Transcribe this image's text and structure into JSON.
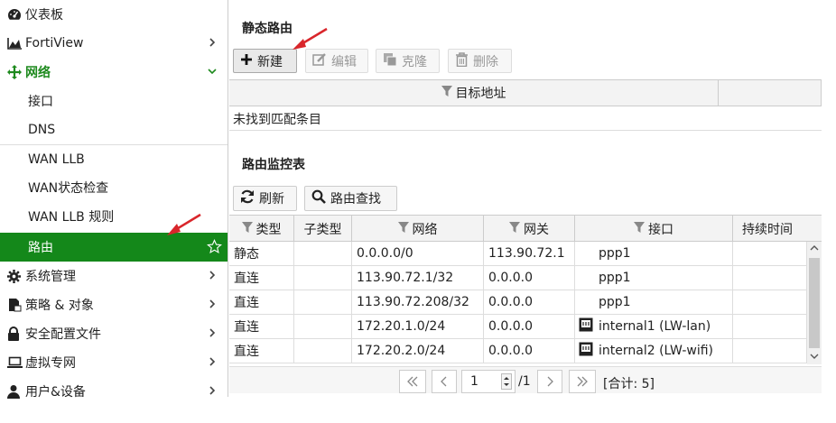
{
  "sidebar": {
    "items": [
      {
        "label": "仪表板",
        "icon": "dashboard-icon"
      },
      {
        "label": "FortiView",
        "icon": "fortiview-chart-icon"
      },
      {
        "label": "网络",
        "icon": "network-move-icon"
      },
      {
        "label": "接口"
      },
      {
        "label": "DNS"
      },
      {
        "label": "WAN LLB"
      },
      {
        "label": "WAN状态检查"
      },
      {
        "label": "WAN LLB 规则"
      },
      {
        "label": "路由"
      },
      {
        "label": "系统管理",
        "icon": "gear-icon"
      },
      {
        "label": "策略 & 对象",
        "icon": "policy-icon"
      },
      {
        "label": "安全配置文件",
        "icon": "lock-icon"
      },
      {
        "label": "虚拟专网",
        "icon": "laptop-icon"
      },
      {
        "label": "用户&设备",
        "icon": "user-icon"
      }
    ]
  },
  "static_route": {
    "title": "静态路由",
    "buttons": {
      "new": "新建",
      "edit": "编辑",
      "clone": "克隆",
      "delete": "删除"
    },
    "columns": [
      "目标地址"
    ],
    "empty": "未找到匹配条目"
  },
  "monitor": {
    "title": "路由监控表",
    "buttons": {
      "refresh": "刷新",
      "lookup": "路由查找"
    },
    "columns": [
      "类型",
      "子类型",
      "网络",
      "网关",
      "接口",
      "持续时间"
    ],
    "rows": [
      {
        "type": "静态",
        "subtype": "",
        "network": "0.0.0.0/0",
        "gateway": "113.90.72.1",
        "iface": "ppp1",
        "iface_icon": false,
        "duration": ""
      },
      {
        "type": "直连",
        "subtype": "",
        "network": "113.90.72.1/32",
        "gateway": "0.0.0.0",
        "iface": "ppp1",
        "iface_icon": false,
        "duration": ""
      },
      {
        "type": "直连",
        "subtype": "",
        "network": "113.90.72.208/32",
        "gateway": "0.0.0.0",
        "iface": "ppp1",
        "iface_icon": false,
        "duration": ""
      },
      {
        "type": "直连",
        "subtype": "",
        "network": "172.20.1.0/24",
        "gateway": "0.0.0.0",
        "iface": "internal1 (LW-lan)",
        "iface_icon": true,
        "duration": ""
      },
      {
        "type": "直连",
        "subtype": "",
        "network": "172.20.2.0/24",
        "gateway": "0.0.0.0",
        "iface": "internal2 (LW-wifi)",
        "iface_icon": true,
        "duration": ""
      }
    ],
    "pager": {
      "page": "1",
      "total_pages": "/1",
      "total": "[合计: 5]"
    }
  },
  "colors": {
    "accent": "#14881a",
    "annotation_arrow": "#d9262b"
  }
}
